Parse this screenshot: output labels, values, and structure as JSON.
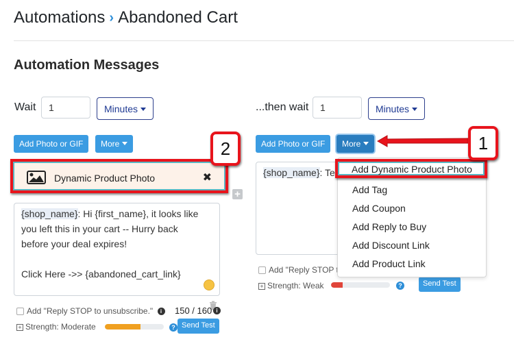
{
  "header": {
    "breadcrumb_root": "Automations",
    "breadcrumb_sep": "›",
    "breadcrumb_current": "Abandoned Cart",
    "section_title": "Automation Messages"
  },
  "colors": {
    "accent_blue": "#3b9ce2",
    "annotation_red": "#e8141c",
    "strength_moderate": "#f0a020",
    "strength_weak": "#e0453a"
  },
  "message1": {
    "wait_label": "Wait",
    "wait_value": "1",
    "unit": "Minutes",
    "add_photo_label": "Add Photo or GIF",
    "more_label": "More",
    "attachment_label": "Dynamic Product Photo",
    "attachment_icon": "image-icon",
    "remove_icon": "close-icon",
    "add_icon": "plus-icon",
    "body_token": "{shop_name}",
    "body_lines": [
      ": Hi {first_name}, it looks like",
      "you left this in your cart -- Hurry back",
      "before your deal expires!",
      "",
      "Click Here ->> {abandoned_cart_link}"
    ],
    "reply_stop_label": "Add \"Reply STOP to unsubscribe.\"",
    "char_count": "150 / 160",
    "strength_label": "Strength: Moderate",
    "strength_percent": 60,
    "send_test_label": "Send Test"
  },
  "message2": {
    "wait_label": "...then wait",
    "wait_value": "1",
    "unit": "Minutes",
    "add_photo_label": "Add Photo or GIF",
    "more_label": "More",
    "body_token": "{shop_name}",
    "body_visible": ": Te",
    "reply_stop_label": "Add \"Reply STOP t",
    "strength_label": "Strength: Weak",
    "strength_percent": 20,
    "send_test_label": "Send Test"
  },
  "more_menu": {
    "items": [
      "Add Dynamic Product Photo",
      "Add Tag",
      "Add Coupon",
      "Add Reply to Buy",
      "Add Discount Link",
      "Add Product Link"
    ]
  },
  "annotations": {
    "step1": "1",
    "step2": "2"
  }
}
